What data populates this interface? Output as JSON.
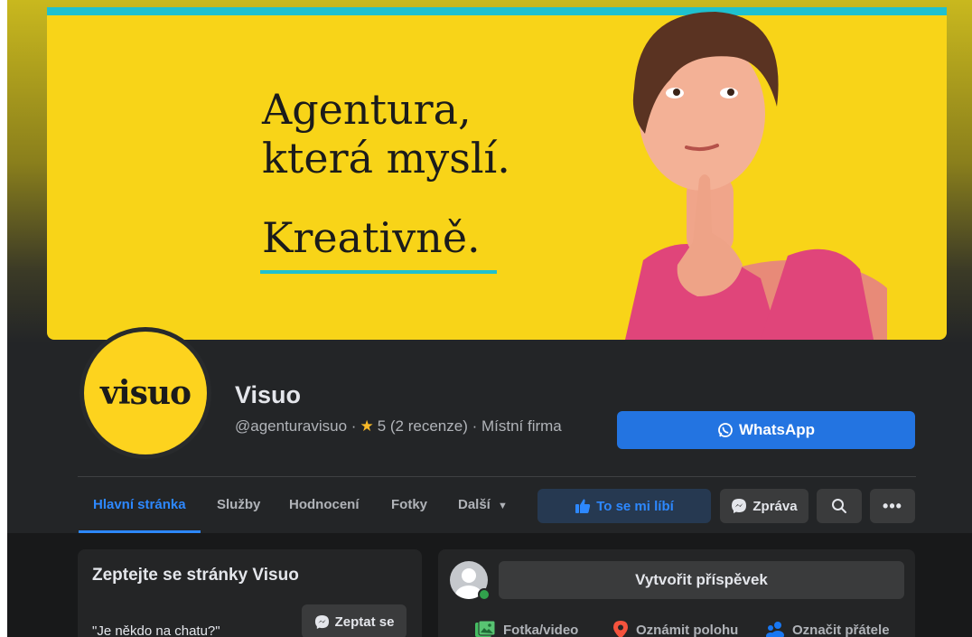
{
  "cover": {
    "headline_line1": "Agentura,",
    "headline_line2": "která myslí.",
    "headline_line3": "Kreativně."
  },
  "profile": {
    "logo_text": "visuo",
    "name": "Visuo",
    "handle": "@agenturavisuo ·",
    "rating": "5 (2 recenze) · Místní firma",
    "whatsapp_label": "WhatsApp"
  },
  "tabs": [
    {
      "label": "Hlavní stránka",
      "active": true
    },
    {
      "label": "Služby"
    },
    {
      "label": "Hodnocení"
    },
    {
      "label": "Fotky"
    },
    {
      "label": "Další"
    }
  ],
  "actions": {
    "like_label": "To se mi líbí",
    "message_label": "Zpráva"
  },
  "ask_card": {
    "title": "Zeptejte se stránky Visuo",
    "quote": "\"Je někdo na chatu?\"",
    "ask_button": "Zeptat se"
  },
  "composer": {
    "create_post": "Vytvořit příspěvek",
    "photo_video": "Fotka/video",
    "location": "Oznámit polohu",
    "tag_friends": "Označit přátele"
  },
  "colors": {
    "accent": "#2374e1",
    "cover_yellow": "#f8d418",
    "cover_teal": "#1ec1cf",
    "background": "#18191a",
    "card": "#242526"
  }
}
